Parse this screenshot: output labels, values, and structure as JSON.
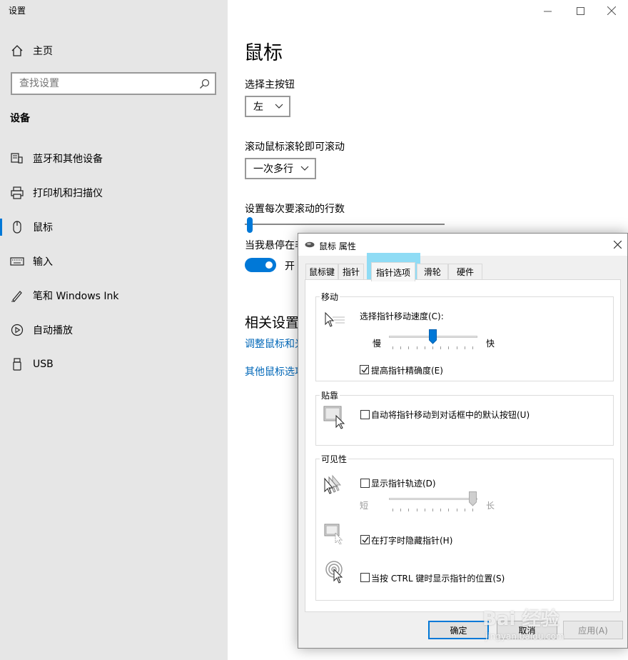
{
  "window": {
    "title": "设置"
  },
  "sidebar": {
    "home_label": "主页",
    "search_placeholder": "查找设置",
    "section_title": "设备",
    "items": [
      {
        "label": "蓝牙和其他设备",
        "icon": "bluetooth-devices-icon"
      },
      {
        "label": "打印机和扫描仪",
        "icon": "printer-icon"
      },
      {
        "label": "鼠标",
        "icon": "mouse-icon",
        "active": true
      },
      {
        "label": "输入",
        "icon": "keyboard-icon"
      },
      {
        "label": "笔和 Windows Ink",
        "icon": "pen-icon"
      },
      {
        "label": "自动播放",
        "icon": "autoplay-icon"
      },
      {
        "label": "USB",
        "icon": "usb-icon"
      }
    ]
  },
  "main": {
    "page_title": "鼠标",
    "primary_button_label": "选择主按钮",
    "primary_button_value": "左",
    "scroll_label": "滚动鼠标滚轮即可滚动",
    "scroll_value": "一次多行",
    "lines_label": "设置每次要滚动的行数",
    "lines_slider_fraction": 0.01,
    "hover_label": "当我悬停在非",
    "hover_toggle_state": "开",
    "related_title": "相关设置",
    "related_link_1": "调整鼠标和光",
    "related_link_2": "其他鼠标选项",
    "accent_color": "#0078d7"
  },
  "dialog": {
    "title": "鼠标 属性",
    "tabs": [
      "鼠标键",
      "指针",
      "指针选项",
      "滑轮",
      "硬件"
    ],
    "active_tab": "指针选项",
    "motion": {
      "group_title": "移动",
      "speed_label": "选择指针移动速度(C):",
      "slow": "慢",
      "fast": "快",
      "speed_fraction": 0.5,
      "precision_label": "提高指针精确度(E)",
      "precision_checked": true
    },
    "snap": {
      "group_title": "贴靠",
      "snap_label": "自动将指针移动到对话框中的默认按钮(U)",
      "snap_checked": false
    },
    "visibility": {
      "group_title": "可见性",
      "trails_label": "显示指针轨迹(D)",
      "trails_checked": false,
      "short": "短",
      "long": "长",
      "trails_fraction": 1.0,
      "hide_label": "在打字时隐藏指针(H)",
      "hide_checked": true,
      "ctrl_label": "当按 CTRL 键时显示指针的位置(S)",
      "ctrl_checked": false
    },
    "buttons": {
      "ok": "确定",
      "cancel": "取消",
      "apply": "应用(A)"
    }
  },
  "watermark": {
    "text": "Bai 经验",
    "subtext": "jingyan.baidu.com"
  }
}
